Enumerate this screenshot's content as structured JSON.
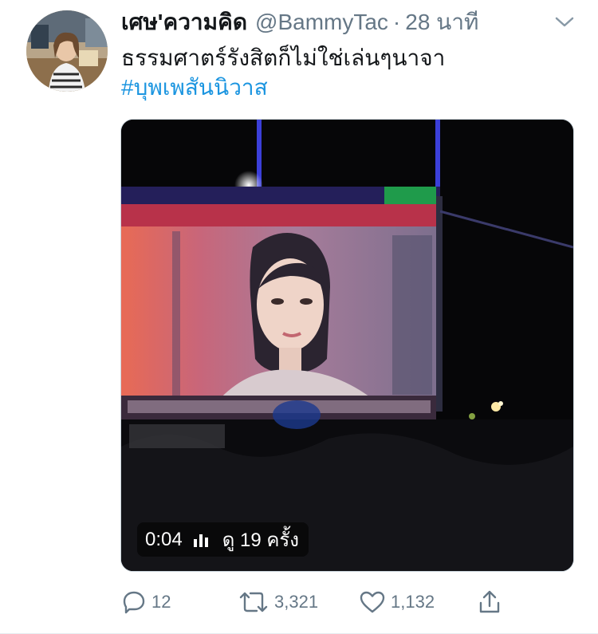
{
  "tweet": {
    "display_name": "เศษ'ความคิด",
    "handle": "@BammyTac",
    "separator": "·",
    "time": "28 นาที",
    "text": "ธรรมศาตร์รังสิตก็ไม่ใช่เล่นๆนาจา",
    "hashtag": "#บุพเพสันนิวาส"
  },
  "media": {
    "video_time": "0:04",
    "view_count_text": "ดู 19 ครั้ง"
  },
  "actions": {
    "reply_count": "12",
    "retweet_count": "3,321",
    "like_count": "1,132"
  },
  "icons": {
    "caret": "chevron-down-icon",
    "reply": "reply-icon",
    "retweet": "retweet-icon",
    "like": "heart-icon",
    "share": "share-icon"
  },
  "colors": {
    "link": "#1b95e0",
    "secondary_text": "#657786",
    "primary_text": "#14171a"
  }
}
